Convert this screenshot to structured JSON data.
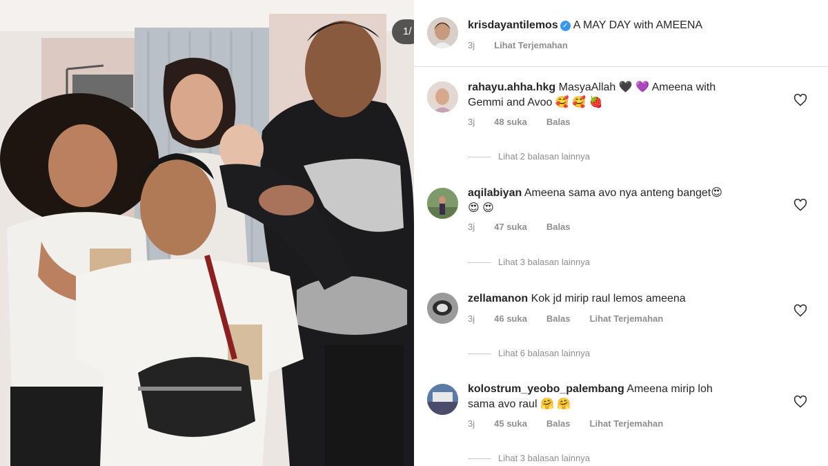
{
  "photo": {
    "page_indicator": "1/"
  },
  "post": {
    "author": "krisdayantilemos",
    "caption": "A MAY DAY with AMEENA",
    "time": "3j",
    "translate": "Lihat Terjemahan"
  },
  "comments": [
    {
      "user": "rahayu.ahha.hkg",
      "text_line1": "MasyaAllah 🖤 💜  Ameena with",
      "text_line2": "Gemmi and Avoo 🥰 🥰 🍓",
      "time": "3j",
      "likes": "48 suka",
      "reply": "Balas",
      "translate": "",
      "view_replies": "Lihat 2 balasan lainnya"
    },
    {
      "user": "aqilabiyan",
      "text_line1": "Ameena sama avo nya anteng banget😍",
      "text_line2": "😍 😍",
      "time": "3j",
      "likes": "47 suka",
      "reply": "Balas",
      "translate": "",
      "view_replies": "Lihat 3 balasan lainnya"
    },
    {
      "user": "zellamanon",
      "text_line1": "Kok jd mirip raul lemos ameena",
      "text_line2": "",
      "time": "3j",
      "likes": "46 suka",
      "reply": "Balas",
      "translate": "Lihat Terjemahan",
      "view_replies": "Lihat 6 balasan lainnya"
    },
    {
      "user": "kolostrum_yeobo_palembang",
      "text_line1": "Ameena mirip loh",
      "text_line2": "sama avo raul 🤗 🤗",
      "time": "3j",
      "likes": "45 suka",
      "reply": "Balas",
      "translate": "Lihat Terjemahan",
      "view_replies": "Lihat 3 balasan lainnya"
    }
  ],
  "icons": {
    "like": "heart-outline-icon",
    "verified": "verified-badge-icon"
  },
  "colors": {
    "muted_text": "#8e8e8e",
    "verified_blue": "#3897f0",
    "divider": "#dbdbdb"
  }
}
